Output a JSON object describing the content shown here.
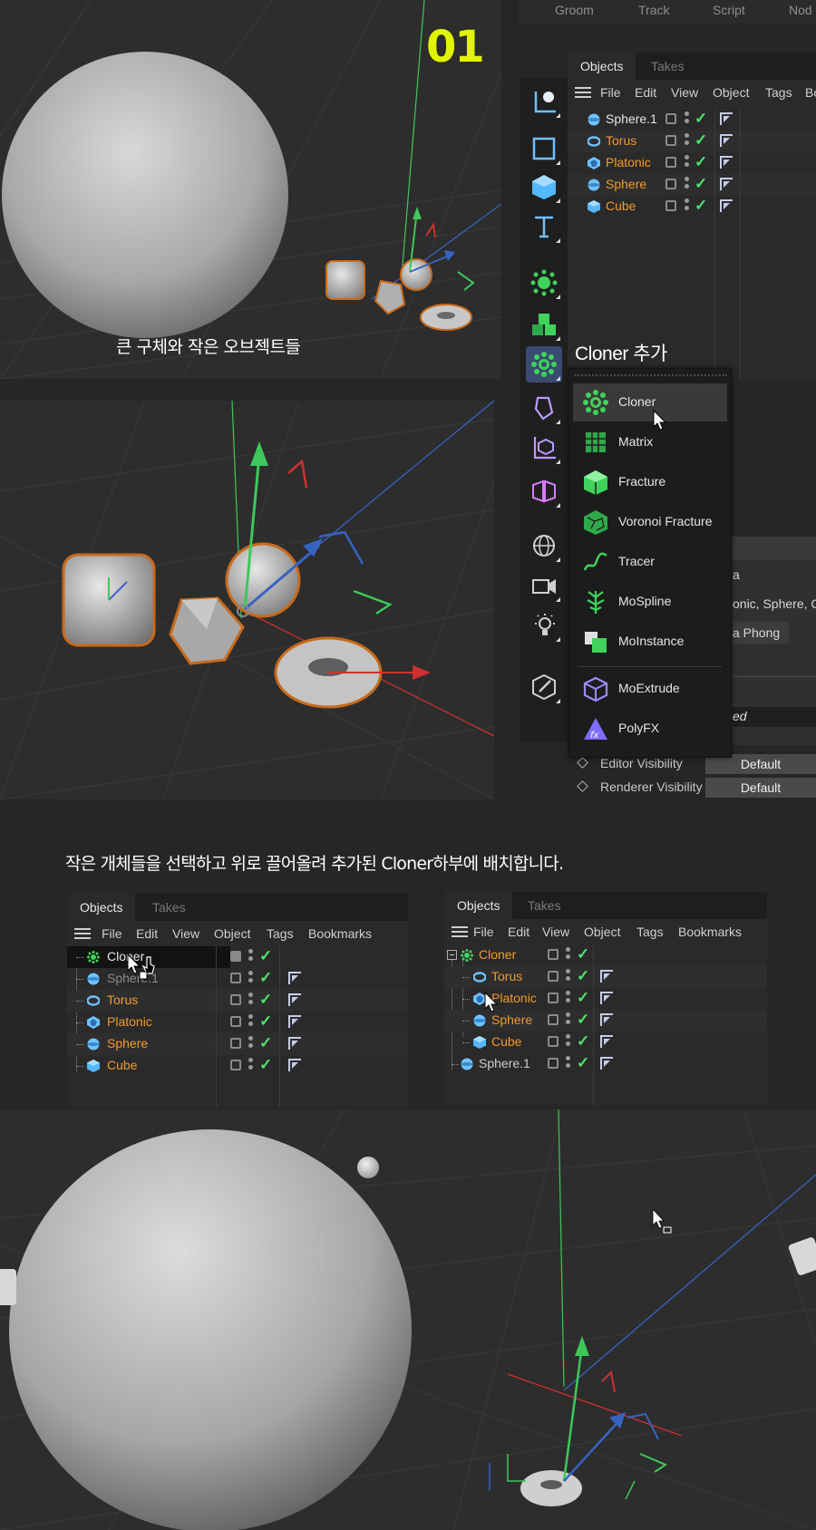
{
  "step_number": "01",
  "caption_top": "큰 구체와 작은 오브젝트들",
  "caption_add_cloner": "Cloner 추가",
  "caption_middle": "작은 개체들을 선택하고 위로 끌어올려 추가된 Cloner하부에 배치합니다.",
  "top_menu": [
    "Groom",
    "Track",
    "Script",
    "Nod"
  ],
  "object_manager_top": {
    "tabs": [
      "Objects",
      "Takes"
    ],
    "menu": [
      "File",
      "Edit",
      "View",
      "Object",
      "Tags",
      "Bo"
    ],
    "rows": [
      "Sphere.1",
      "Torus",
      "Platonic",
      "Sphere",
      "Cube"
    ]
  },
  "dropdown": {
    "items": [
      "Cloner",
      "Matrix",
      "Fracture",
      "Voronoi Fracture",
      "Tracer",
      "MoSpline",
      "MoInstance",
      "MoExtrude",
      "PolyFX"
    ]
  },
  "attributes": {
    "frag1": "a",
    "frag2": "onic, Sphere, Cu",
    "frag3": "a Phong",
    "frag4": "ed"
  },
  "visibility": {
    "editor_label": "Editor Visibility",
    "editor_value": "Default",
    "renderer_label": "Renderer Visibility",
    "renderer_value": "Default"
  },
  "object_manager_left": {
    "tabs": [
      "Objects",
      "Takes"
    ],
    "menu": [
      "File",
      "Edit",
      "View",
      "Object",
      "Tags",
      "Bookmarks"
    ],
    "rows": [
      "Cloner",
      "Sphere.1",
      "Torus",
      "Platonic",
      "Sphere",
      "Cube"
    ]
  },
  "object_manager_right": {
    "tabs": [
      "Objects",
      "Takes"
    ],
    "menu": [
      "File",
      "Edit",
      "View",
      "Object",
      "Tags",
      "Bookmarks"
    ],
    "rows": [
      "Cloner",
      "Torus",
      "Platonic",
      "Sphere",
      "Cube",
      "Sphere.1"
    ]
  },
  "colors": {
    "accent_yellow": "#e2f500",
    "orange_name": "#f39a2b",
    "check_green": "#4ee26c",
    "mograph_green": "#3fd35c",
    "selected_tool": "#3a4a70"
  }
}
